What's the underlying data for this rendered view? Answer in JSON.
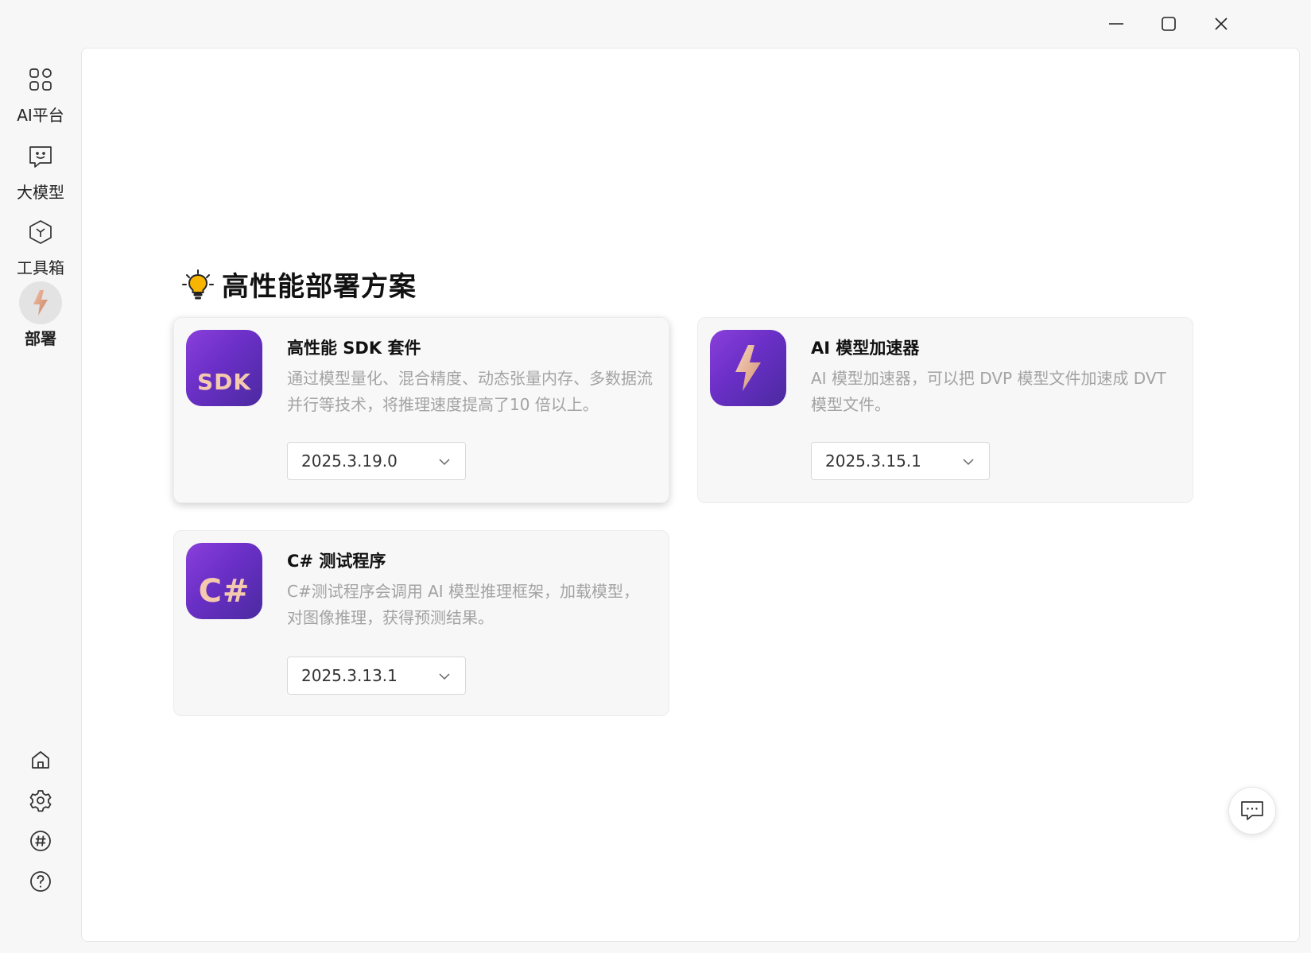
{
  "window_controls": {
    "minimize": "minimize-icon",
    "maximize": "maximize-icon",
    "close": "close-icon"
  },
  "sidebar": {
    "items": [
      {
        "label": "AI平台",
        "icon": "grid-icon",
        "active": false
      },
      {
        "label": "大模型",
        "icon": "chat-face-icon",
        "active": false
      },
      {
        "label": "工具箱",
        "icon": "cube-icon",
        "active": false
      },
      {
        "label": "部署",
        "icon": "lightning-icon",
        "active": true
      }
    ],
    "bottom_icons": [
      "home-icon",
      "settings-icon",
      "hashtag-icon",
      "help-icon"
    ]
  },
  "main": {
    "section_title": "高性能部署方案",
    "section_icon": "lightbulb-icon",
    "cards": [
      {
        "title": "高性能 SDK 套件",
        "description": "通过模型量化、混合精度、动态张量内存、多数据流并行等技术，将推理速度提高了10 倍以上。",
        "logo_text": "SDK",
        "version": "2025.3.19.0"
      },
      {
        "title": "AI 模型加速器",
        "description": "AI 模型加速器，可以把 DVP 模型文件加速成 DVT 模型文件。",
        "logo_icon": "lightning-icon",
        "version": "2025.3.15.1"
      },
      {
        "title": "C# 测试程序",
        "description": "C#测试程序会调用 AI 模型推理框架，加载模型，对图像推理，获得预测结果。",
        "logo_text": "C#",
        "version": "2025.3.13.1"
      }
    ]
  },
  "colors": {
    "accent_purple": "#6a2fc6",
    "logo_text": "#f4c9ad",
    "bulb_yellow": "#f5b800"
  }
}
